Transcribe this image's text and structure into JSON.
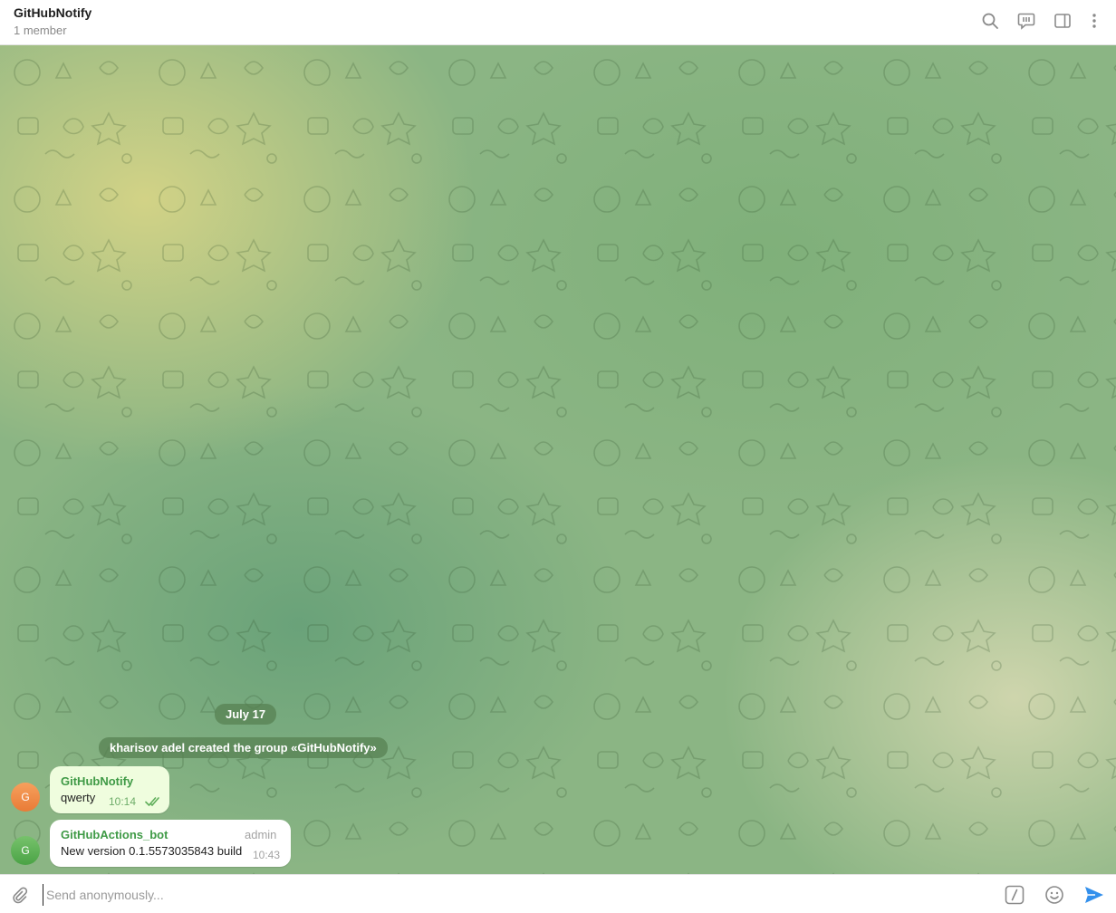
{
  "header": {
    "title": "GitHubNotify",
    "subtitle": "1 member",
    "icons": [
      "search-icon",
      "discussion-icon",
      "sidebar-toggle-icon",
      "more-vertical-icon"
    ]
  },
  "chat": {
    "date_separator": "July 17",
    "service_message": "kharisov adel created the group «GitHubNotify»",
    "messages": [
      {
        "avatar_letter": "G",
        "sender": "GitHubNotify",
        "text": "qwerty",
        "time": "10:14",
        "status": "read"
      },
      {
        "avatar_letter": "G",
        "sender": "GitHubActions_bot",
        "role": "admin",
        "text": "New version 0.1.5573035843 build",
        "time": "10:43"
      }
    ]
  },
  "composer": {
    "placeholder": "Send anonymously...",
    "icons": [
      "attach-icon",
      "bot-commands-icon",
      "emoji-icon",
      "send-icon"
    ]
  },
  "colors": {
    "accent": "#3390ec",
    "sender_name": "#3f9a46",
    "own_bubble": "#effdde"
  }
}
